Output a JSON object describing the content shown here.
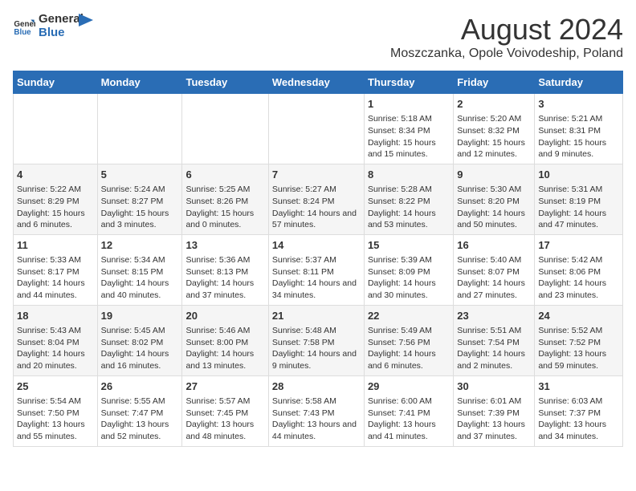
{
  "header": {
    "logo_general": "General",
    "logo_blue": "Blue",
    "main_title": "August 2024",
    "subtitle": "Moszczanka, Opole Voivodeship, Poland"
  },
  "calendar": {
    "days_of_week": [
      "Sunday",
      "Monday",
      "Tuesday",
      "Wednesday",
      "Thursday",
      "Friday",
      "Saturday"
    ],
    "weeks": [
      [
        {
          "day": "",
          "info": ""
        },
        {
          "day": "",
          "info": ""
        },
        {
          "day": "",
          "info": ""
        },
        {
          "day": "",
          "info": ""
        },
        {
          "day": "1",
          "info": "Sunrise: 5:18 AM\nSunset: 8:34 PM\nDaylight: 15 hours and 15 minutes."
        },
        {
          "day": "2",
          "info": "Sunrise: 5:20 AM\nSunset: 8:32 PM\nDaylight: 15 hours and 12 minutes."
        },
        {
          "day": "3",
          "info": "Sunrise: 5:21 AM\nSunset: 8:31 PM\nDaylight: 15 hours and 9 minutes."
        }
      ],
      [
        {
          "day": "4",
          "info": "Sunrise: 5:22 AM\nSunset: 8:29 PM\nDaylight: 15 hours and 6 minutes."
        },
        {
          "day": "5",
          "info": "Sunrise: 5:24 AM\nSunset: 8:27 PM\nDaylight: 15 hours and 3 minutes."
        },
        {
          "day": "6",
          "info": "Sunrise: 5:25 AM\nSunset: 8:26 PM\nDaylight: 15 hours and 0 minutes."
        },
        {
          "day": "7",
          "info": "Sunrise: 5:27 AM\nSunset: 8:24 PM\nDaylight: 14 hours and 57 minutes."
        },
        {
          "day": "8",
          "info": "Sunrise: 5:28 AM\nSunset: 8:22 PM\nDaylight: 14 hours and 53 minutes."
        },
        {
          "day": "9",
          "info": "Sunrise: 5:30 AM\nSunset: 8:20 PM\nDaylight: 14 hours and 50 minutes."
        },
        {
          "day": "10",
          "info": "Sunrise: 5:31 AM\nSunset: 8:19 PM\nDaylight: 14 hours and 47 minutes."
        }
      ],
      [
        {
          "day": "11",
          "info": "Sunrise: 5:33 AM\nSunset: 8:17 PM\nDaylight: 14 hours and 44 minutes."
        },
        {
          "day": "12",
          "info": "Sunrise: 5:34 AM\nSunset: 8:15 PM\nDaylight: 14 hours and 40 minutes."
        },
        {
          "day": "13",
          "info": "Sunrise: 5:36 AM\nSunset: 8:13 PM\nDaylight: 14 hours and 37 minutes."
        },
        {
          "day": "14",
          "info": "Sunrise: 5:37 AM\nSunset: 8:11 PM\nDaylight: 14 hours and 34 minutes."
        },
        {
          "day": "15",
          "info": "Sunrise: 5:39 AM\nSunset: 8:09 PM\nDaylight: 14 hours and 30 minutes."
        },
        {
          "day": "16",
          "info": "Sunrise: 5:40 AM\nSunset: 8:07 PM\nDaylight: 14 hours and 27 minutes."
        },
        {
          "day": "17",
          "info": "Sunrise: 5:42 AM\nSunset: 8:06 PM\nDaylight: 14 hours and 23 minutes."
        }
      ],
      [
        {
          "day": "18",
          "info": "Sunrise: 5:43 AM\nSunset: 8:04 PM\nDaylight: 14 hours and 20 minutes."
        },
        {
          "day": "19",
          "info": "Sunrise: 5:45 AM\nSunset: 8:02 PM\nDaylight: 14 hours and 16 minutes."
        },
        {
          "day": "20",
          "info": "Sunrise: 5:46 AM\nSunset: 8:00 PM\nDaylight: 14 hours and 13 minutes."
        },
        {
          "day": "21",
          "info": "Sunrise: 5:48 AM\nSunset: 7:58 PM\nDaylight: 14 hours and 9 minutes."
        },
        {
          "day": "22",
          "info": "Sunrise: 5:49 AM\nSunset: 7:56 PM\nDaylight: 14 hours and 6 minutes."
        },
        {
          "day": "23",
          "info": "Sunrise: 5:51 AM\nSunset: 7:54 PM\nDaylight: 14 hours and 2 minutes."
        },
        {
          "day": "24",
          "info": "Sunrise: 5:52 AM\nSunset: 7:52 PM\nDaylight: 13 hours and 59 minutes."
        }
      ],
      [
        {
          "day": "25",
          "info": "Sunrise: 5:54 AM\nSunset: 7:50 PM\nDaylight: 13 hours and 55 minutes."
        },
        {
          "day": "26",
          "info": "Sunrise: 5:55 AM\nSunset: 7:47 PM\nDaylight: 13 hours and 52 minutes."
        },
        {
          "day": "27",
          "info": "Sunrise: 5:57 AM\nSunset: 7:45 PM\nDaylight: 13 hours and 48 minutes."
        },
        {
          "day": "28",
          "info": "Sunrise: 5:58 AM\nSunset: 7:43 PM\nDaylight: 13 hours and 44 minutes."
        },
        {
          "day": "29",
          "info": "Sunrise: 6:00 AM\nSunset: 7:41 PM\nDaylight: 13 hours and 41 minutes."
        },
        {
          "day": "30",
          "info": "Sunrise: 6:01 AM\nSunset: 7:39 PM\nDaylight: 13 hours and 37 minutes."
        },
        {
          "day": "31",
          "info": "Sunrise: 6:03 AM\nSunset: 7:37 PM\nDaylight: 13 hours and 34 minutes."
        }
      ]
    ]
  }
}
